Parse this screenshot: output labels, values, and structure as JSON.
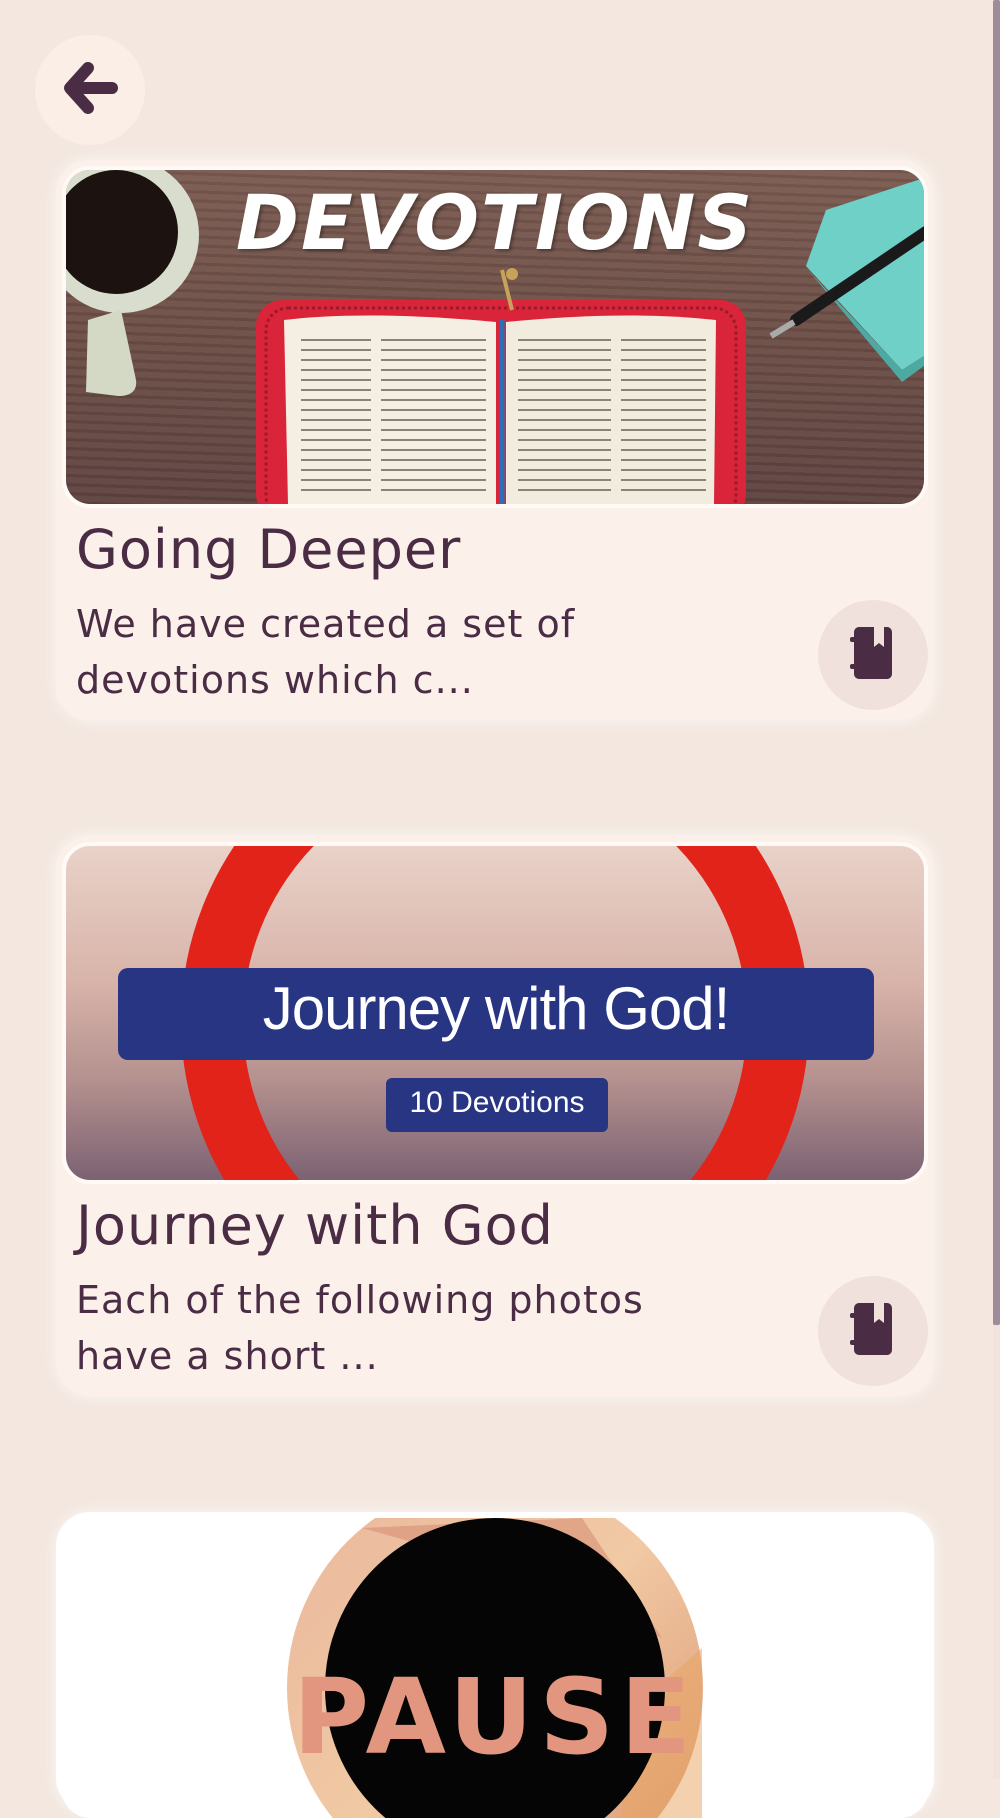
{
  "nav": {
    "back_icon": "arrow-left-icon"
  },
  "cards": [
    {
      "image_caption": "DEVOTIONS",
      "title": "Going Deeper",
      "description": "We have created a set of devotions which c...",
      "action_icon": "book-bookmark-icon"
    },
    {
      "image_caption": "Journey with God!",
      "image_subcaption": "10 Devotions",
      "title": "Journey with God",
      "description": "Each of the following photos have a short ...",
      "action_icon": "book-bookmark-icon"
    },
    {
      "image_caption": "PAUSE"
    }
  ],
  "colors": {
    "background": "#f3e7df",
    "card": "#fcf1ea",
    "text": "#4a2c45",
    "icon_button": "#f0e1dc",
    "journey_banner": "#283583",
    "journey_ring": "#e2231a"
  }
}
